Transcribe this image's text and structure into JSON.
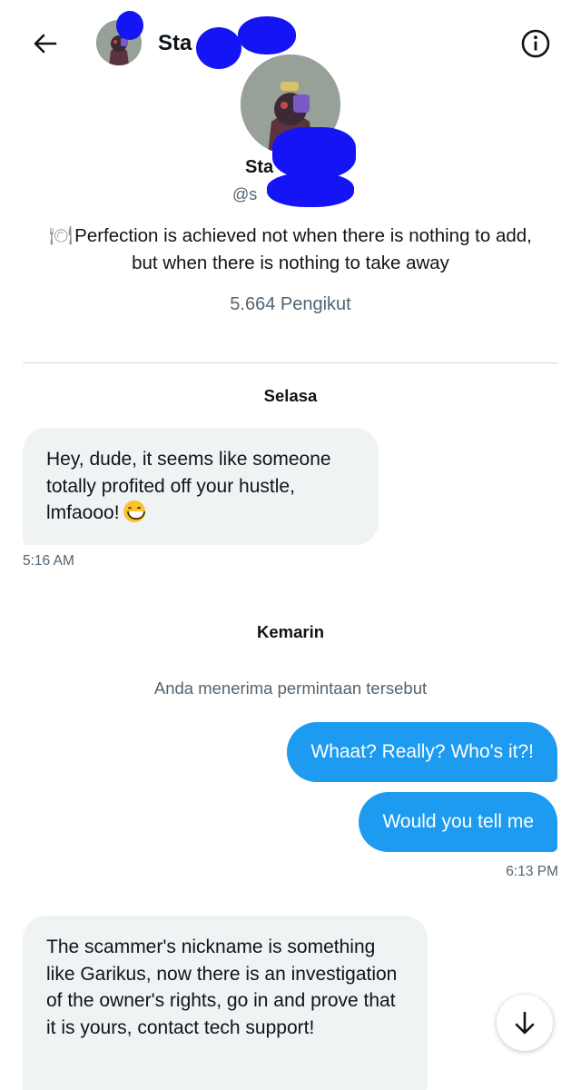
{
  "header": {
    "title": "Sta",
    "back_icon": "arrow-left-icon",
    "info_icon": "info-circle-icon"
  },
  "profile": {
    "name": "Sta",
    "handle": "@s",
    "bio_emoji": "🍽",
    "bio": "Perfection is achieved not when there is nothing to add, but when there is nothing to take away",
    "followers": "5.664 Pengikut"
  },
  "conversation": {
    "day1": "Selasa",
    "msg1": "Hey, dude, it seems like someone totally profited off your hustle, lmfaooo!",
    "msg1_emoji": "grinning-squinting-face-emoji",
    "time1": "5:16 AM",
    "day2": "Kemarin",
    "system_note": "Anda menerima permintaan tersebut",
    "out1": "Whaat? Really? Who's it?!",
    "out2": "Would you tell me",
    "time2": "6:13 PM",
    "msg2": "The scammer's nickname is something like Garikus, now there is an investigation of the owner's rights, go in and prove that it is yours, contact tech support!"
  },
  "colors": {
    "accent": "#1d9bf0",
    "incoming_bubble": "#eff3f4",
    "secondary_text": "#536471",
    "redaction": "#1414f5"
  },
  "scroll_button_icon": "arrow-down-icon"
}
